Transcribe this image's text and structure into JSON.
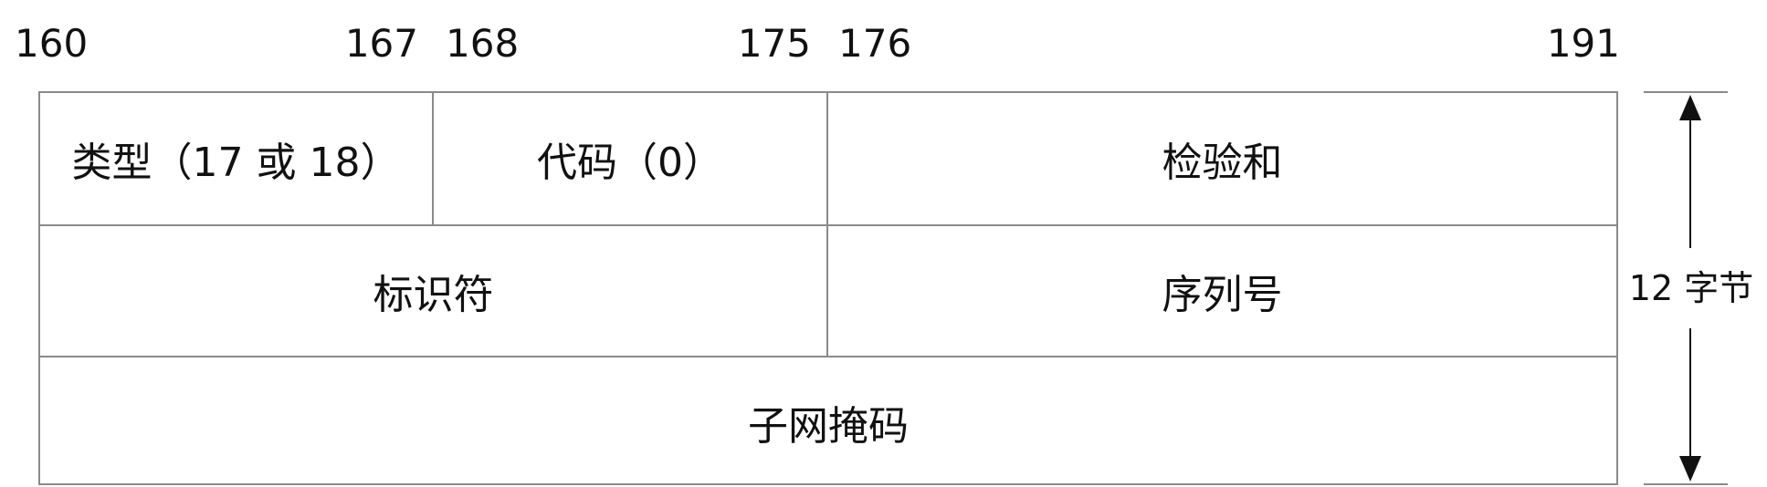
{
  "bit_ticks": [
    "160",
    "167",
    "168",
    "175",
    "176",
    "191"
  ],
  "rows": [
    {
      "fields": [
        {
          "label": "类型（17 或 18）"
        },
        {
          "label": "代码（0）"
        },
        {
          "label": "检验和"
        }
      ]
    },
    {
      "fields": [
        {
          "label": "标识符"
        },
        {
          "label": "序列号"
        }
      ]
    },
    {
      "fields": [
        {
          "label": "子网掩码"
        }
      ]
    }
  ],
  "size_label": "12 字节"
}
